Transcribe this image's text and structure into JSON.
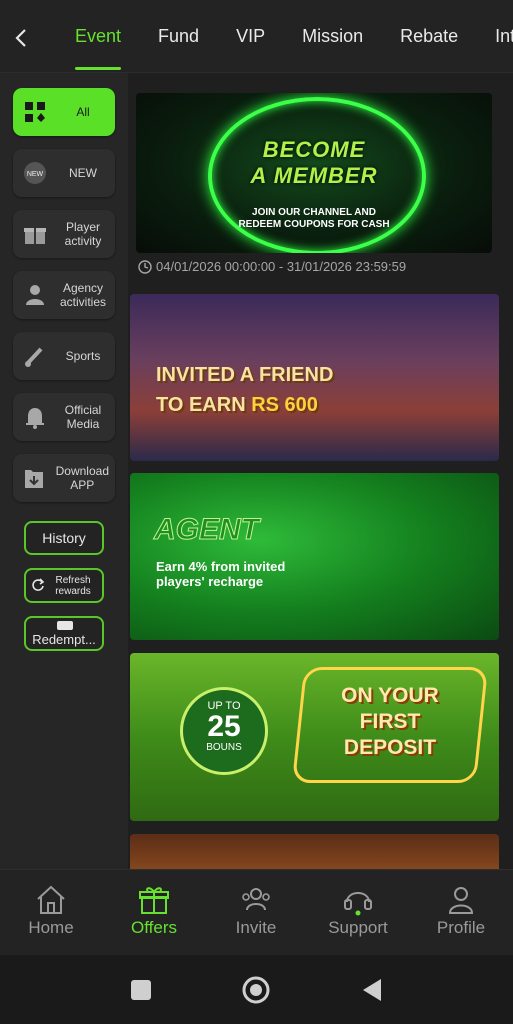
{
  "header": {
    "tabs": [
      "Event",
      "Fund",
      "VIP",
      "Mission",
      "Rebate",
      "Int"
    ],
    "active_tab": "Event"
  },
  "sidebar": {
    "items": [
      {
        "label": "All",
        "icon": "grid-icon"
      },
      {
        "label": "NEW",
        "icon": "new-badge-icon"
      },
      {
        "label": "Player activity",
        "icon": "gift-icon"
      },
      {
        "label": "Agency activities",
        "icon": "agent-icon"
      },
      {
        "label": "Sports",
        "icon": "sports-icon"
      },
      {
        "label": "Official Media",
        "icon": "bell-icon"
      },
      {
        "label": "Download APP",
        "icon": "download-icon"
      }
    ],
    "history_label": "History",
    "refresh_label": "Refresh rewards",
    "redeem_label": "Redempt..."
  },
  "banners": {
    "member": {
      "line1": "BECOME",
      "line2": "A MEMBER",
      "sub1": "JOIN OUR CHANNEL AND",
      "sub2": "REDEEM COUPONS FOR CASH",
      "date_range": "04/01/2026 00:00:00 - 31/01/2026 23:59:59"
    },
    "invite": {
      "line1": "INVITED A FRIEND",
      "line2_prefix": "TO EARN ",
      "line2_amount": "RS 600"
    },
    "agent": {
      "title": "AGENT",
      "sub1": "Earn 4% from invited",
      "sub2": "players' recharge"
    },
    "deposit": {
      "up_to": "UP TO",
      "percent": "25",
      "bouns": "BOUNS",
      "line1": "ON YOUR",
      "line2": "FIRST",
      "line3": "DEPOSIT"
    }
  },
  "bottom_nav": [
    {
      "label": "Home",
      "icon": "home-icon"
    },
    {
      "label": "Offers",
      "icon": "offers-gift-icon"
    },
    {
      "label": "Invite",
      "icon": "invite-icon"
    },
    {
      "label": "Support",
      "icon": "headset-icon"
    },
    {
      "label": "Profile",
      "icon": "profile-icon"
    }
  ],
  "colors": {
    "accent": "#67e12f",
    "background": "#1f1f1f"
  }
}
